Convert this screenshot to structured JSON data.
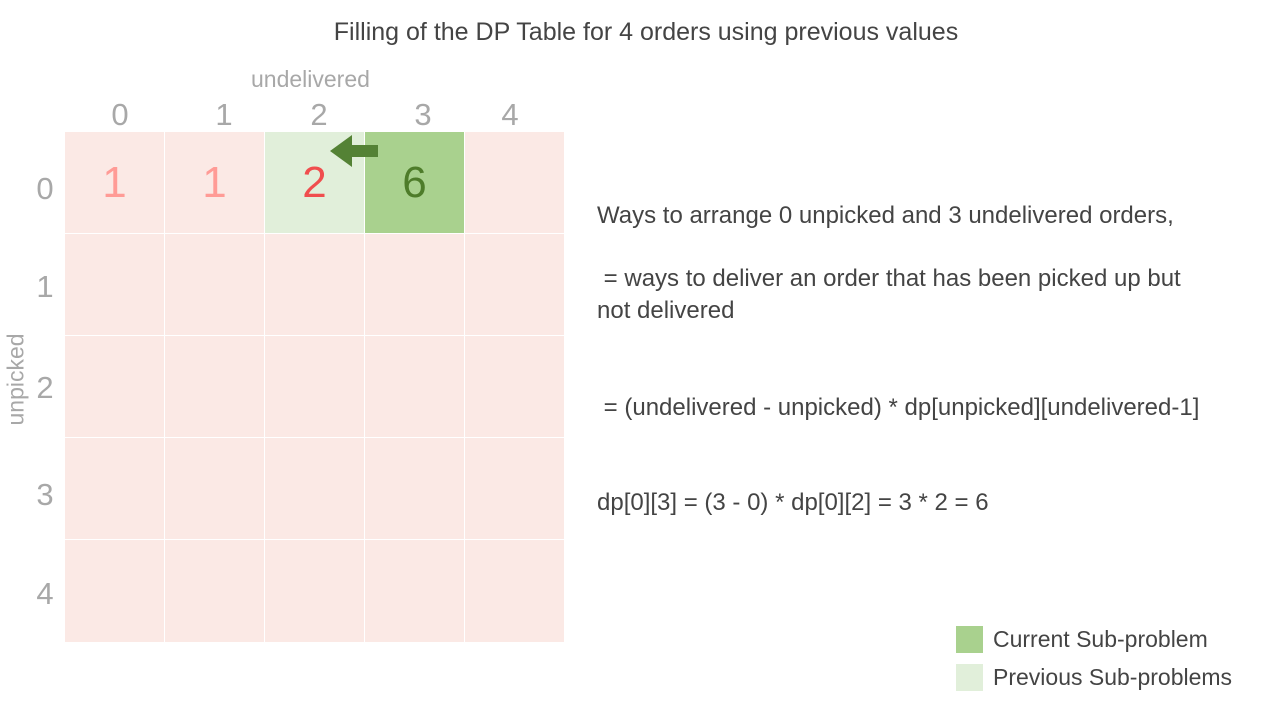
{
  "title": "Filling of the DP Table for 4 orders using previous values",
  "x_axis_title": "undelivered",
  "y_axis_title": "unpicked",
  "column_labels": [
    "0",
    "1",
    "2",
    "3",
    "4"
  ],
  "row_labels": [
    "0",
    "1",
    "2",
    "3",
    "4"
  ],
  "table": {
    "rows": [
      [
        "1",
        "1",
        "2",
        "6",
        ""
      ],
      [
        "",
        "",
        "",
        "",
        ""
      ],
      [
        "",
        "",
        "",
        "",
        ""
      ],
      [
        "",
        "",
        "",
        "",
        ""
      ],
      [
        "",
        "",
        "",
        "",
        ""
      ]
    ],
    "cell_states": [
      [
        "done",
        "done",
        "previous",
        "current",
        "empty"
      ],
      [
        "empty",
        "empty",
        "empty",
        "empty",
        "empty"
      ],
      [
        "empty",
        "empty",
        "empty",
        "empty",
        "empty"
      ],
      [
        "empty",
        "empty",
        "empty",
        "empty",
        "empty"
      ],
      [
        "empty",
        "empty",
        "empty",
        "empty",
        "empty"
      ]
    ]
  },
  "arrow_icon": "left-arrow-icon",
  "explanation": {
    "line1": "Ways to arrange 0 unpicked and 3 undelivered orders,",
    "line2": " = ways to deliver an order that has been picked up but\nnot delivered",
    "line3": " = (undelivered - unpicked) * dp[unpicked][undelivered-1]",
    "line4": "dp[0][3] = (3 - 0) * dp[0][2] = 3 * 2 = 6"
  },
  "legend": [
    {
      "label": "Current Sub-problem",
      "color": "#a9d18e"
    },
    {
      "label": "Previous Sub-problems",
      "color": "#e1efda"
    }
  ],
  "colors": {
    "empty_cell": "#fbe9e5",
    "done_value": "#ff9b96",
    "previous_value": "#f04e4e",
    "current_value": "#4e7c2a",
    "arrow": "#548235"
  }
}
